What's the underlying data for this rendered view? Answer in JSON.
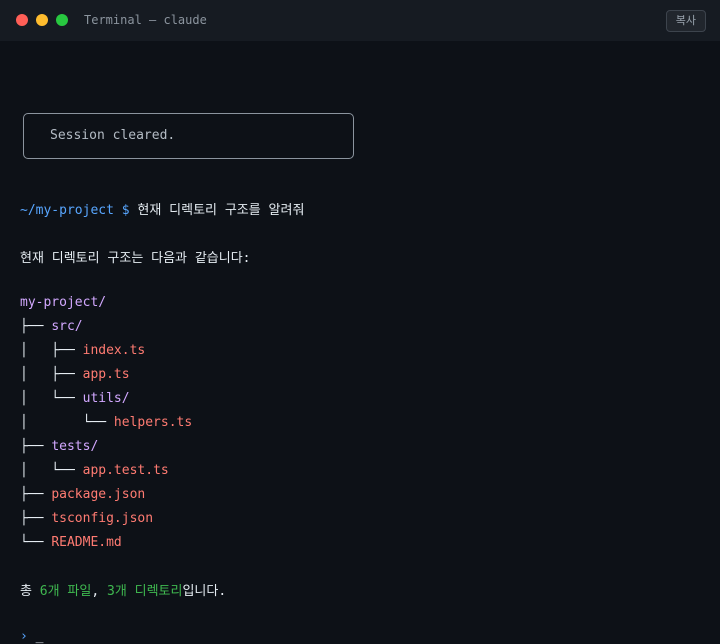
{
  "window": {
    "title": "Terminal — claude",
    "copy_label": "복사"
  },
  "banner": {
    "text": "Session cleared."
  },
  "prompt": {
    "path": "~/my-project",
    "symbol": "$",
    "command": "현재 디렉토리 구조를 알려줘"
  },
  "response": {
    "intro": "현재 디렉토리 구조는 다음과 같습니다:",
    "tree": [
      {
        "prefix": "",
        "name": "my-project/",
        "kind": "dir"
      },
      {
        "prefix": "├── ",
        "name": "src/",
        "kind": "dir"
      },
      {
        "prefix": "│   ├── ",
        "name": "index.ts",
        "kind": "file"
      },
      {
        "prefix": "│   ├── ",
        "name": "app.ts",
        "kind": "file"
      },
      {
        "prefix": "│   └── ",
        "name": "utils/",
        "kind": "dir"
      },
      {
        "prefix": "│       └── ",
        "name": "helpers.ts",
        "kind": "file"
      },
      {
        "prefix": "├── ",
        "name": "tests/",
        "kind": "dir"
      },
      {
        "prefix": "│   └── ",
        "name": "app.test.ts",
        "kind": "file"
      },
      {
        "prefix": "├── ",
        "name": "package.json",
        "kind": "file"
      },
      {
        "prefix": "├── ",
        "name": "tsconfig.json",
        "kind": "file"
      },
      {
        "prefix": "└── ",
        "name": "README.md",
        "kind": "file"
      }
    ],
    "summary": {
      "lead": "총 ",
      "files": "6개 파일",
      "sep": ", ",
      "dirs": "3개 디렉토리",
      "tail": "입니다."
    }
  },
  "input": {
    "prompt": "›",
    "cursor": "_"
  },
  "colors": {
    "background": "#0d1117",
    "prompt": "#58a6ff",
    "dir": "#d2a8ff",
    "file": "#ff7b72",
    "highlight": "#3fb950"
  }
}
